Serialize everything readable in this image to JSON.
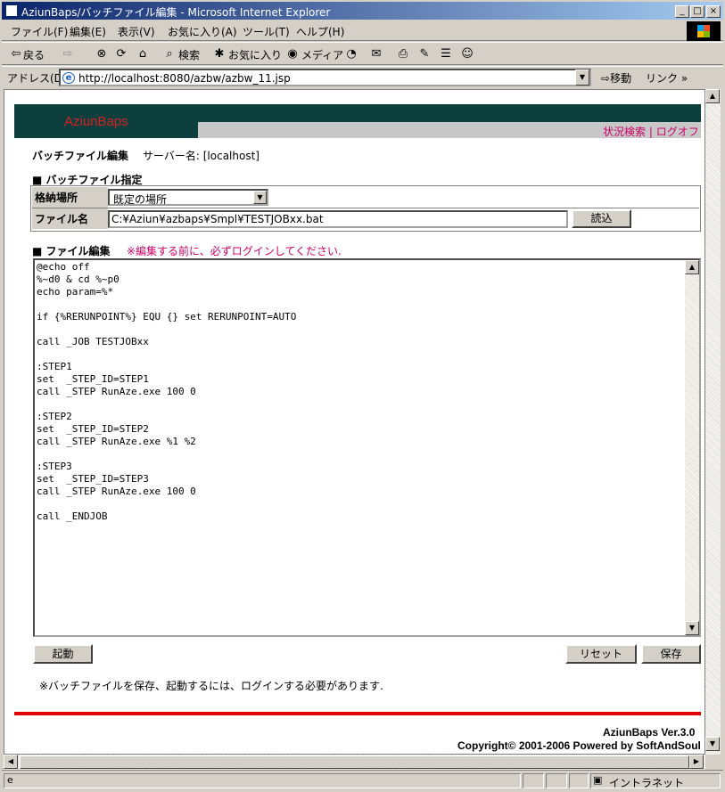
{
  "window": {
    "title": "AziunBaps/バッチファイル編集 - Microsoft Internet Explorer",
    "minimize": "_",
    "maximize": "□",
    "close": "×"
  },
  "menubar": [
    "ファイル(F)",
    "編集(E)",
    "表示(V)",
    "お気に入り(A)",
    "ツール(T)",
    "ヘルプ(H)"
  ],
  "toolbar": {
    "back": "戻る",
    "search": "検索",
    "favorites": "お気に入り",
    "media": "メディア"
  },
  "address": {
    "label": "アドレス(D)",
    "url": "http://localhost:8080/azbw/azbw_11.jsp",
    "go": "移動",
    "links": "リンク"
  },
  "page": {
    "logo": "AziunBaps",
    "toplinks": [
      "状況検索",
      "ログオフ"
    ],
    "separator": "|",
    "heading": "バッチファイル編集",
    "server": "サーバー名: [localhost]",
    "spec_section": "■ バッチファイル指定",
    "location_label": "格納場所",
    "location_value": "既定の場所",
    "filename_label": "ファイル名",
    "filename_value": "C:¥Aziun¥azbaps¥Smpl¥TESTJOBxx.bat",
    "read_button": "読込",
    "edit_section": "■ ファイル編集",
    "warning": "※編集する前に、必ずログインしてください.",
    "editor_content": "@echo off\n%~d0 & cd %~p0\necho param=%*\n\nif {%RERUNPOINT%} EQU {} set RERUNPOINT=AUTO\n\ncall _JOB TESTJOBxx\n\n:STEP1\nset  _STEP_ID=STEP1\ncall _STEP RunAze.exe 100 0\n\n:STEP2\nset  _STEP_ID=STEP2\ncall _STEP RunAze.exe %1 %2\n\n:STEP3\nset  _STEP_ID=STEP3\ncall _STEP RunAze.exe 100 0\n\ncall _ENDJOB",
    "start_button": "起動",
    "reset_button": "リセット",
    "save_button": "保存",
    "note": "※バッチファイルを保存、起動するには、ログインする必要があります.",
    "version": "AziunBaps Ver.3.0",
    "copyright": "Copyright© 2001-2006 Powered by SoftAndSoul"
  },
  "status": {
    "zone": "イントラネット"
  },
  "colors": {
    "banner": "#0d3f3f",
    "logo": "#d82020",
    "link": "#cc0066",
    "rule": "#e00000"
  }
}
